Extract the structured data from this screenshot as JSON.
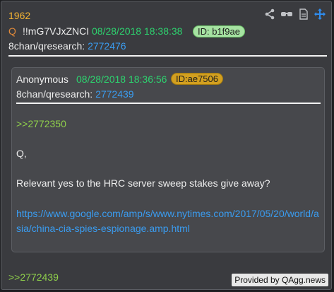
{
  "post": {
    "number": "1962",
    "q_marker": "Q",
    "tripcode": "!!mG7VJxZNCI",
    "date": "08/28/2018 18:38:38",
    "id": "ID: b1f9ae",
    "board": "8chan/qresearch:",
    "post_ref": "2772476"
  },
  "quoted": {
    "author": "Anonymous",
    "date": "08/28/2018 18:36:56",
    "id": "ID:ae7506",
    "board": "8chan/qresearch:",
    "post_ref": "2772439",
    "reply_ref": ">>2772350",
    "text1": "Q,",
    "text2": "Relevant yes to the HRC server sweep stakes give away?",
    "url": "https://www.google.com/amp/s/www.nytimes.com/2017/05/20/world/asia/china-cia-spies-espionage.amp.html"
  },
  "footer": {
    "reply_ref": ">>2772439",
    "credit": "Provided by QAgg.news"
  },
  "toolbar": {
    "icons": [
      "share-icon",
      "glasses-icon",
      "document-icon",
      "move-icon"
    ]
  },
  "colors": {
    "post_number": "#f2b233",
    "date": "#2dd36f",
    "link": "#3a9cf0",
    "greentext": "#8fcf4b",
    "id_main_bg": "#a6e3a2",
    "id_quote_bg": "#d3a020"
  }
}
